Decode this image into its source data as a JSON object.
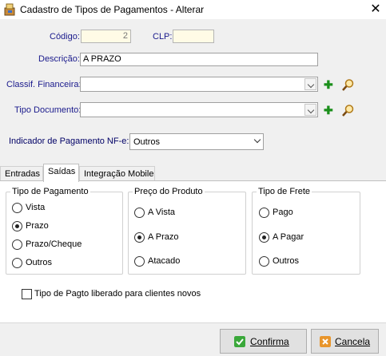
{
  "window": {
    "title": "Cadastro de Tipos de Pagamentos - Alterar",
    "close_glyph": "✕"
  },
  "form": {
    "codigo_label": "Código:",
    "codigo_value": "2",
    "clp_label": "CLP:",
    "clp_value": "",
    "descricao_label": "Descrição:",
    "descricao_value": "A PRAZO",
    "classif_label": "Classif. Financeira:",
    "classif_value": "",
    "tipo_doc_label": "Tipo Documento:",
    "tipo_doc_value": "",
    "indicador_label": "Indicador de Pagamento NF-e:",
    "indicador_value": "Outros",
    "add_glyph": "✚"
  },
  "tabs": [
    {
      "label": "Entradas"
    },
    {
      "label": "Saídas"
    },
    {
      "label": "Integração Mobile"
    }
  ],
  "tipo_pagamento": {
    "title": "Tipo de Pagamento",
    "options": [
      "Vista",
      "Prazo",
      "Prazo/Cheque",
      "Outros"
    ],
    "selected_index": 1
  },
  "preco_produto": {
    "title": "Preço do Produto",
    "options": [
      "A Vista",
      "A Prazo",
      "Atacado"
    ],
    "selected_index": 1
  },
  "tipo_frete": {
    "title": "Tipo de Frete",
    "options": [
      "Pago",
      "A Pagar",
      "Outros"
    ],
    "selected_index": 1
  },
  "liberado_checkbox": {
    "label": "Tipo de Pagto liberado para clientes novos",
    "checked": false
  },
  "buttons": {
    "confirma": "Confirma",
    "cancela": "Cancela"
  },
  "colors": {
    "label_blue": "#1a1a8c",
    "confirm_icon": "#3aa83a",
    "cancel_icon": "#e8952b"
  }
}
